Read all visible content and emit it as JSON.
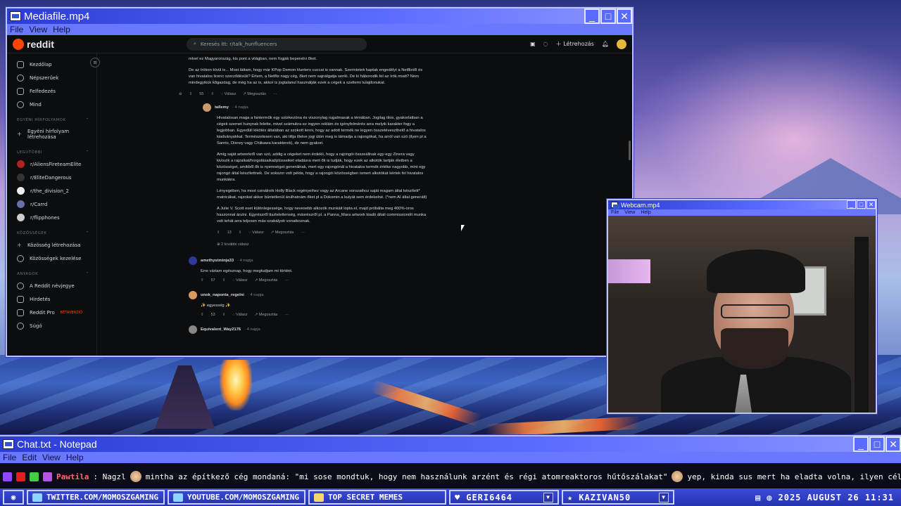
{
  "media_window": {
    "title": "Mediafile.mp4",
    "menu": [
      "File",
      "View",
      "Help"
    ]
  },
  "reddit": {
    "logo_text": "reddit",
    "search_placeholder": "Keresés itt: r/talk_hunfluencers",
    "create_label": "Létrehozás",
    "nav": [
      "Kezdőlap",
      "Népszerűek",
      "Felfedezés",
      "Mind"
    ],
    "sections": {
      "custom_feeds": "EGYÉNI HÍRFOLYAMOK",
      "recent": "LEGUTÓBBI",
      "communities": "KÖZÖSSÉGEK",
      "resources": "ANYAGOK"
    },
    "custom_feed_item": "Egyéni hírfolyam létrehozása",
    "recent_items": [
      "r/AliensFireteamElite",
      "r/EliteDangerous",
      "r/the_division_2",
      "r/Carrd",
      "r/flipphones"
    ],
    "community_items": [
      "Közösség létrehozása",
      "Közösségek kezelése"
    ],
    "resource_items": [
      "A Reddit névjegye",
      "Hirdetés",
      "Reddit Pro",
      "Súgó"
    ],
    "reddit_pro_badge": "BÉTAVERZIÓ",
    "top_text_1": "mivel ez Magyarország, kis pont a világban, nem fogják beperelni őket.",
    "top_text_2": "De az írókon kívül is... Most láttam, hogy már KPop Demon Hunters cuccai is vannak. Szerintetek kaptak engedélyt a Netflixtől és van hivatalos licenc szerződésük? Értem, a Netflix nagy cég, őket nem sajnálgatja senki. De ki háborodik fel az írók miatt? Nem mindegyikük kőgazdag, de még ha az is, akkor is jogtalanul használják ezek a cégek a szellemi tulajdonukat.",
    "top_actions": {
      "votes": "55",
      "reply": "Válasz",
      "share": "Megosztás"
    },
    "reply1": {
      "user": "tallemy",
      "time": "4 napja",
      "p1": "Hivatalosan maga a fanterműk egy szürkezóna és viszonylag rugalmasak a témában. Jogilag tilos, gyakorlatban a cégek szemet hunynak felette, mivel számukra ez ingyen reklám és igényfelmérés arra melyik karakter fogy a legjobban. Egyedüli kikötés általában az szokott lenni, hogy az adott termék ne legyen összetéveszthető a hivatalos kiadványokkal. Természetesen van, aki tiltja illetve jogi úton meg is támadja a rajongókat, ha arról van szó (ilyen pl a Sanrio, Disney vagy Chiikawa karakterek), de nem gyakori.",
      "p2": "Amíg saját artworkről van szó, addig a cégeket nem érdekli, hogy a rajongói összeállnak egy-egy Zinera vagy kiviszik a rajzaikat/horgolásaikat/plüsseiket eladásra mert ők is tudják, hogy ezek az alkotók tartják életben a közösséget, amikből ők is nyereséget generálnak, mert egy rajongónál a hivatalos termék értéke nagyobb, mint egy rajongó által készítettnek. De sokszor volt példa, hogy a rajongói közösségben ismert alkotókat kértek fel hivatalos munkákra.",
      "p3": "Lényegében, ha most csinálnék Holly Black regényeihez vagy az Arcane sorozathoz saját magam által készített* matricákat, rajzokat akkor büntetlenül árulhatnám őket pl a Dokomin a kutyát sem érdekelné. (*nem AI által generált)",
      "p4": "A Julie V. Scott eset különlegessége, hogy nevesebb alkozók munkáit lopta el, majd próbálta meg 400%-oros haszonnal árulni. Egyrészről tiszteletlenség, másrészről pl. a Panna_Mara artwork kiadó általi commissionölt munka volt tehát arra teljesen más szabályok vonatkoznak.",
      "votes": "13",
      "reply": "Válasz",
      "share": "Megosztás"
    },
    "more_replies": "2 további válasz",
    "c2": {
      "user": "amethystminja33",
      "time": "4 napja",
      "text": "Erre vártam egésznap, hogy megtudjam mi történt.",
      "votes": "57",
      "reply": "Válasz",
      "share": "Megosztás"
    },
    "c3": {
      "user": "unok_naponta_regelni",
      "time": "4 napja",
      "text": "✨ egyesség ✨",
      "votes": "53",
      "reply": "Válasz",
      "share": "Megosztás"
    },
    "c4": {
      "user": "Equivalent_Way2176",
      "time": "4 napja"
    }
  },
  "webcam_window": {
    "title": "Webcam.mp4",
    "menu": [
      "File",
      "View",
      "Help"
    ]
  },
  "chat_window": {
    "title": "Chat.txt - Notepad",
    "menu": [
      "File",
      "Edit",
      "View",
      "Help"
    ],
    "line_user": "Pawtila",
    "line_msg1": ": Nagzl",
    "line_msg2": "mintha az építkező cég mondaná: \"mi sose mondtuk, hogy nem használunk arzént és régi atomreaktoros hűtőszálakat\"",
    "line_msg3": "yep, kinda sus  mert ha eladta volna, ilyen céllal, akkor nem lenne issue neki  mennyibe kerül?  az komoly"
  },
  "taskbar": {
    "items": [
      "TWITTER.COM/MOMOSZGAMING",
      "YOUTUBE.COM/MOMOSZGAMING",
      "TOP SECRET MEMES"
    ],
    "users": [
      "GERI6464",
      "KAZIVAN50"
    ],
    "clock": "2025 AUGUST 26 11:31"
  },
  "colors": {
    "window_title_blue": "#2b3dd6",
    "reddit_orange": "#ff4500",
    "reddit_bg": "#0b0d0f",
    "chat_user_red": "#ff6b6b"
  }
}
